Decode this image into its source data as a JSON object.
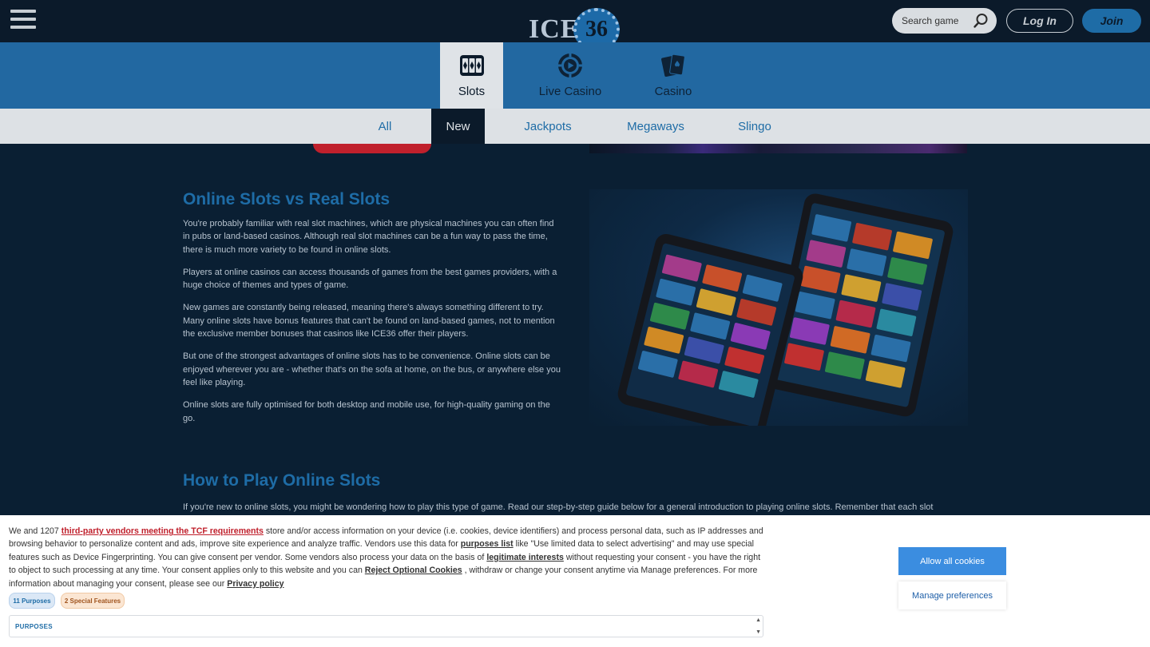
{
  "header": {
    "logo_text": "ICE",
    "logo_number": "36",
    "search_placeholder": "Search game",
    "login_label": "Log In",
    "join_label": "Join"
  },
  "categories": [
    {
      "label": "Slots",
      "icon": "slot-machine-icon",
      "active": true
    },
    {
      "label": "Live Casino",
      "icon": "live-play-icon",
      "active": false
    },
    {
      "label": "Casino",
      "icon": "playing-cards-icon",
      "active": false
    }
  ],
  "subnav": [
    {
      "label": "All",
      "active": false
    },
    {
      "label": "New",
      "active": true
    },
    {
      "label": "Jackpots",
      "active": false
    },
    {
      "label": "Megaways",
      "active": false
    },
    {
      "label": "Slingo",
      "active": false
    }
  ],
  "content": {
    "section1_title": "Online Slots vs Real Slots",
    "section1_paragraphs": [
      "You're probably familiar with real slot machines, which are physical machines you can often find in pubs or land-based casinos. Although real slot machines can be a fun way to pass the time, there is much more variety to be found in online slots.",
      "Players at online casinos can access thousands of games from the best games providers, with a huge choice of themes and types of game.",
      "New games are constantly being released, meaning there's always something different to try. Many online slots have bonus features that can't be found on land-based games, not to mention the exclusive member bonuses that casinos like ICE36 offer their players.",
      "But one of the strongest advantages of online slots has to be convenience. Online slots can be enjoyed wherever you are - whether that's on the sofa at home, on the bus, or anywhere else you feel like playing.",
      "Online slots are fully optimised for both desktop and mobile use, for high-quality gaming on the go."
    ],
    "section2_title": "How to Play Online Slots",
    "section2_intro": "If you're new to online slots, you might be wondering how to play this type of game. Read our step-by-step guide below for a general introduction to playing online slots. Remember that each slot"
  },
  "cookie": {
    "t1": "We and 1207 ",
    "link_vendors": "third-party vendors meeting the TCF requirements",
    "t2": " store and/or access information on your device (i.e. cookies, device identifiers) and process personal data, such as IP addresses and browsing behavior to personalize content and ads, improve site experience and analyze traffic. Vendors use this data for ",
    "link_purposes": "purposes list",
    "t3": "  like \"Use limited data to select advertising\" and may use special features such as Device Fingerprinting. You can give consent per vendor. Some vendors also process your data on the basis of ",
    "link_legit": "legitimate interests",
    "t4": "  without requesting your consent - you have the right to object to such processing at any time. Your consent applies only to this website and you can ",
    "link_reject": "Reject Optional Cookies",
    "t5": " , withdraw or change your consent anytime via Manage preferences. For more information about managing your consent, please see our ",
    "link_privacy": "Privacy policy",
    "pill_purposes": "11 Purposes",
    "pill_features": "2 Special Features",
    "purposes_heading": "PURPOSES",
    "allow_label": "Allow all cookies",
    "manage_label": "Manage preferences"
  },
  "colors": {
    "accent": "#1e6ca6",
    "nav_blue": "#2268a1",
    "background": "#0a1f33",
    "cta_red": "#c0202c",
    "allow_button": "#3b8de0"
  }
}
